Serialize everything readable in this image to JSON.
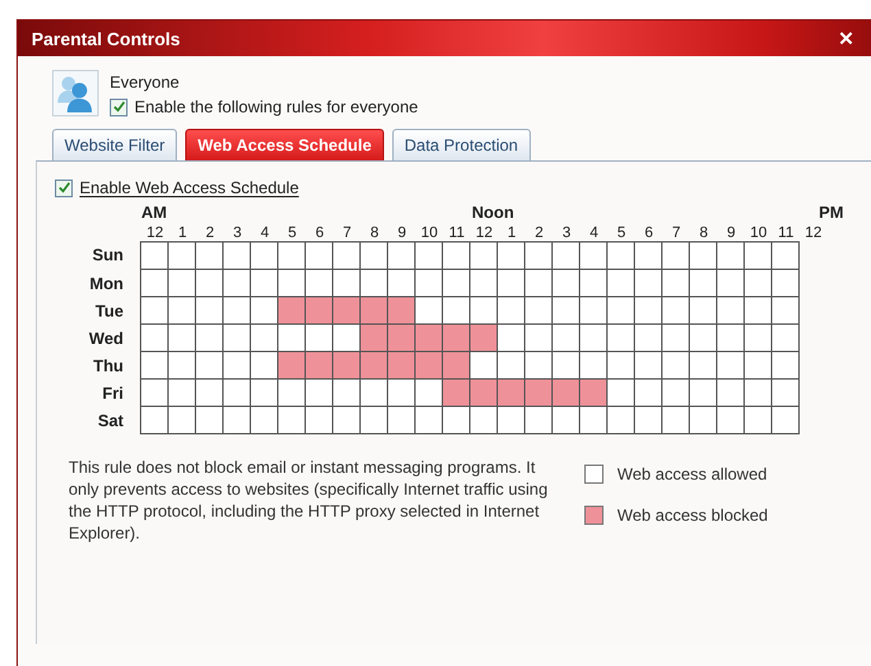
{
  "window": {
    "title": "Parental Controls",
    "close": "✕"
  },
  "user": {
    "name": "Everyone",
    "enable_label": "Enable the following rules for everyone",
    "enabled": true
  },
  "tabs": [
    {
      "label": "Website Filter",
      "selected": false
    },
    {
      "label": "Web Access Schedule",
      "selected": true
    },
    {
      "label": "Data Protection",
      "selected": false
    }
  ],
  "schedule": {
    "enable_label": "Enable Web Access Schedule",
    "enabled": true,
    "period_labels": [
      "AM",
      "Noon",
      "PM"
    ],
    "hour_labels": [
      "12",
      "1",
      "2",
      "3",
      "4",
      "5",
      "6",
      "7",
      "8",
      "9",
      "10",
      "11",
      "12",
      "1",
      "2",
      "3",
      "4",
      "5",
      "6",
      "7",
      "8",
      "9",
      "10",
      "11",
      "12"
    ],
    "days": [
      {
        "label": "Sun",
        "blocked": [
          false,
          false,
          false,
          false,
          false,
          false,
          false,
          false,
          false,
          false,
          false,
          false,
          false,
          false,
          false,
          false,
          false,
          false,
          false,
          false,
          false,
          false,
          false,
          false
        ]
      },
      {
        "label": "Mon",
        "blocked": [
          false,
          false,
          false,
          false,
          false,
          false,
          false,
          false,
          false,
          false,
          false,
          false,
          false,
          false,
          false,
          false,
          false,
          false,
          false,
          false,
          false,
          false,
          false,
          false
        ]
      },
      {
        "label": "Tue",
        "blocked": [
          false,
          false,
          false,
          false,
          false,
          true,
          true,
          true,
          true,
          true,
          false,
          false,
          false,
          false,
          false,
          false,
          false,
          false,
          false,
          false,
          false,
          false,
          false,
          false
        ]
      },
      {
        "label": "Wed",
        "blocked": [
          false,
          false,
          false,
          false,
          false,
          false,
          false,
          false,
          true,
          true,
          true,
          true,
          true,
          false,
          false,
          false,
          false,
          false,
          false,
          false,
          false,
          false,
          false,
          false
        ]
      },
      {
        "label": "Thu",
        "blocked": [
          false,
          false,
          false,
          false,
          false,
          true,
          true,
          true,
          true,
          true,
          true,
          true,
          false,
          false,
          false,
          false,
          false,
          false,
          false,
          false,
          false,
          false,
          false,
          false
        ]
      },
      {
        "label": "Fri",
        "blocked": [
          false,
          false,
          false,
          false,
          false,
          false,
          false,
          false,
          false,
          false,
          false,
          true,
          true,
          true,
          true,
          true,
          true,
          false,
          false,
          false,
          false,
          false,
          false,
          false
        ]
      },
      {
        "label": "Sat",
        "blocked": [
          false,
          false,
          false,
          false,
          false,
          false,
          false,
          false,
          false,
          false,
          false,
          false,
          false,
          false,
          false,
          false,
          false,
          false,
          false,
          false,
          false,
          false,
          false,
          false
        ]
      }
    ]
  },
  "note": "This rule does not block email or instant messaging programs. It only prevents access to websites (specifically Internet traffic using the HTTP protocol, including the HTTP proxy selected in Internet Explorer).",
  "legend": [
    {
      "label": "Web access allowed",
      "blocked": false
    },
    {
      "label": "Web access blocked",
      "blocked": true
    }
  ]
}
